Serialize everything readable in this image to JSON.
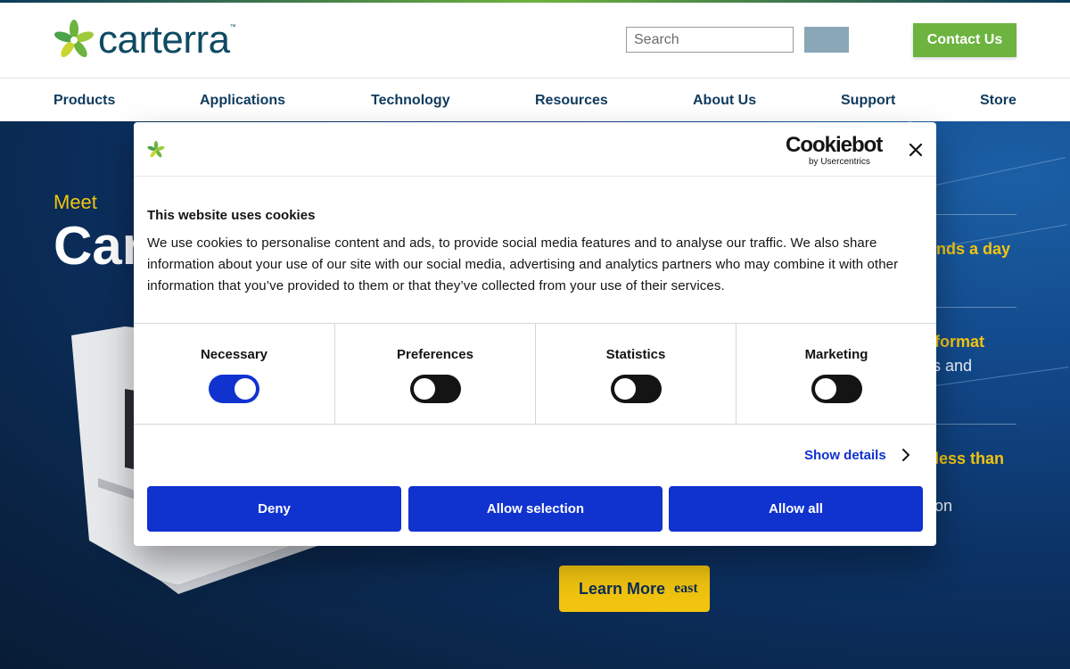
{
  "brand": {
    "name": "carterra",
    "trademark": "™"
  },
  "header": {
    "search_placeholder": "Search",
    "contact_label": "Contact Us"
  },
  "nav": {
    "items": [
      "Products",
      "Applications",
      "Technology",
      "Resources",
      "About Us",
      "Support",
      "Store"
    ]
  },
  "hero": {
    "eyebrow": "Meet",
    "title_partial": "Car",
    "feature1": "nds a day",
    "feature2_yellow": "format",
    "feature2_white": "s and",
    "feature3_yellow": "less than",
    "feature3_white": "on",
    "learn_more": "Learn More",
    "learn_more_extra": "east"
  },
  "cookie_dialog": {
    "provider": "Cookiebot",
    "provider_sub": "by Usercentrics",
    "title": "This website uses cookies",
    "body": "We use cookies to personalise content and ads, to provide social media features and to analyse our traffic. We also share information about your use of our site with our social media, advertising and analytics partners who may combine it with other information that you’ve provided to them or that they’ve collected from your use of their services.",
    "categories": [
      {
        "label": "Necessary",
        "enabled": true
      },
      {
        "label": "Preferences",
        "enabled": false
      },
      {
        "label": "Statistics",
        "enabled": false
      },
      {
        "label": "Marketing",
        "enabled": false
      }
    ],
    "show_details": "Show details",
    "buttons": {
      "deny": "Deny",
      "allow_selection": "Allow selection",
      "allow_all": "Allow all"
    }
  },
  "colors": {
    "brand_navy": "#0f3b5e",
    "brand_green": "#6cb33f",
    "accent_yellow": "#f1c40f",
    "cookiebot_blue": "#1032cf"
  }
}
